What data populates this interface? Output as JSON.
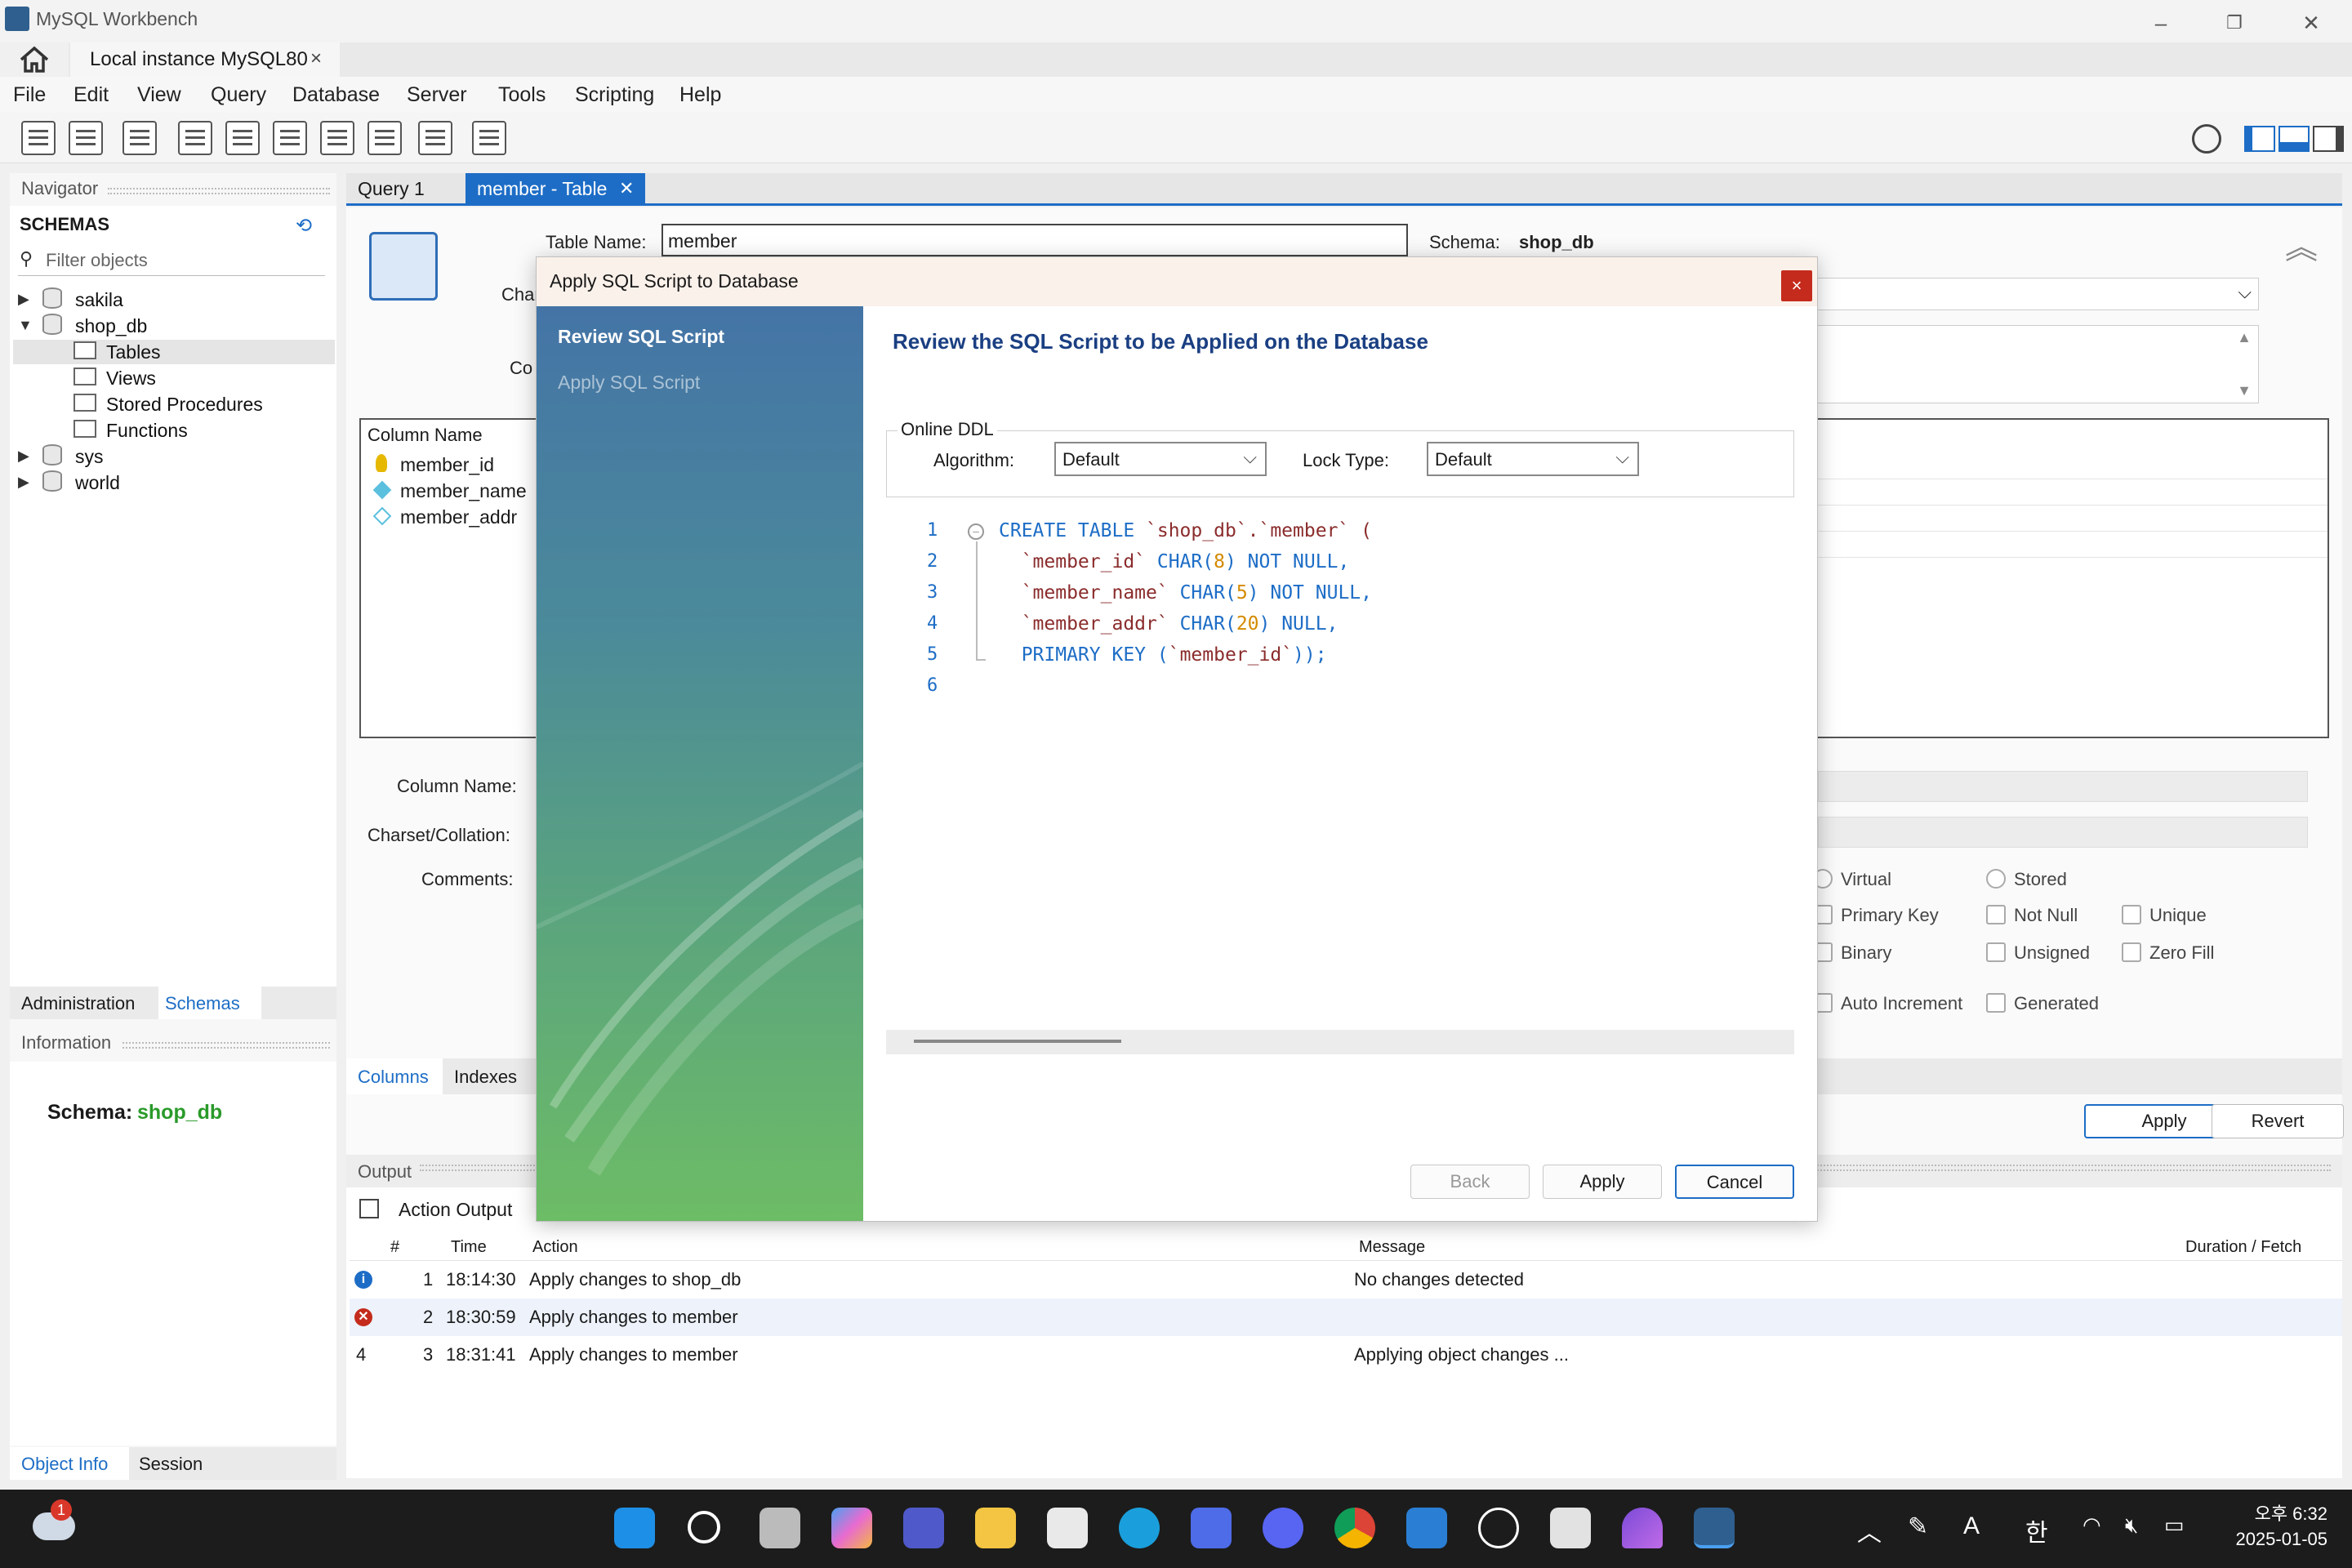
{
  "window": {
    "title": "MySQL Workbench"
  },
  "tabs": {
    "instance": "Local instance MySQL80",
    "close": "×"
  },
  "menu": [
    "File",
    "Edit",
    "View",
    "Query",
    "Database",
    "Server",
    "Tools",
    "Scripting",
    "Help"
  ],
  "navigator": {
    "header": "Navigator",
    "schemas_title": "SCHEMAS",
    "filter_placeholder": "Filter objects",
    "tree": [
      "sakila",
      "shop_db",
      "Tables",
      "Views",
      "Stored Procedures",
      "Functions",
      "sys",
      "world"
    ],
    "tabs": [
      "Administration",
      "Schemas"
    ],
    "info_header": "Information",
    "schema_label": "Schema:",
    "schema_value": "shop_db",
    "bottom_tabs": [
      "Object Info",
      "Session"
    ]
  },
  "editor": {
    "tabs": [
      "Query 1",
      "member - Table"
    ],
    "table_name_label": "Table Name:",
    "table_name_value": "member",
    "schema_label": "Schema:",
    "schema_value": "shop_db",
    "charset_label_partial": "Char",
    "comments_label_partial": "Co",
    "column_header": "Column Name",
    "columns": [
      "member_id",
      "member_name",
      "member_addr"
    ],
    "column_name_label": "Column Name:",
    "charset_collation_label": "Charset/Collation:",
    "comments_label": "Comments:",
    "options": [
      "Virtual",
      "Stored",
      "Primary Key",
      "Not Null",
      "Unique",
      "Binary",
      "Unsigned",
      "Zero Fill",
      "Auto Increment",
      "Generated"
    ],
    "bottom_tabs": [
      "Columns",
      "Indexes"
    ],
    "apply": "Apply",
    "revert": "Revert"
  },
  "output": {
    "header": "Output",
    "selector": "Action Output",
    "columns": [
      "#",
      "Time",
      "Action",
      "Message",
      "Duration / Fetch"
    ],
    "rows": [
      {
        "num": "1",
        "time": "18:14:30",
        "action": "Apply changes to shop_db",
        "message": "No changes detected",
        "status": "info"
      },
      {
        "num": "2",
        "time": "18:30:59",
        "action": "Apply changes to member",
        "message": "",
        "status": "error"
      },
      {
        "num": "3",
        "time": "18:31:41",
        "action": "Apply changes to member",
        "message": "Applying object changes ...",
        "status": "4"
      }
    ]
  },
  "dialog": {
    "title": "Apply SQL Script to Database",
    "close": "×",
    "steps": [
      "Review SQL Script",
      "Apply SQL Script"
    ],
    "heading": "Review the SQL Script to be Applied on the Database",
    "online_ddl": "Online DDL",
    "algorithm_label": "Algorithm:",
    "algorithm_value": "Default",
    "lock_label": "Lock Type:",
    "lock_value": "Default",
    "line_numbers": [
      "1",
      "2",
      "3",
      "4",
      "5",
      "6"
    ],
    "sql": {
      "l1a": "CREATE TABLE",
      "l1b": " `shop_db`.`member` (",
      "l2a": "  `member_id`",
      "l2b": " CHAR(",
      "l2c": "8",
      "l2d": ") NOT NULL,",
      "l3a": "  `member_name`",
      "l3b": " CHAR(",
      "l3c": "5",
      "l3d": ") NOT NULL,",
      "l4a": "  `member_addr`",
      "l4b": " CHAR(",
      "l4c": "20",
      "l4d": ") NULL,",
      "l5a": "  PRIMARY KEY (",
      "l5b": "`member_id`",
      "l5c": "));"
    },
    "buttons": {
      "back": "Back",
      "apply": "Apply",
      "cancel": "Cancel"
    }
  },
  "taskbar": {
    "time": "오후 6:32",
    "date": "2025-01-05",
    "ime": "한",
    "font_a": "A",
    "badge": "1"
  }
}
